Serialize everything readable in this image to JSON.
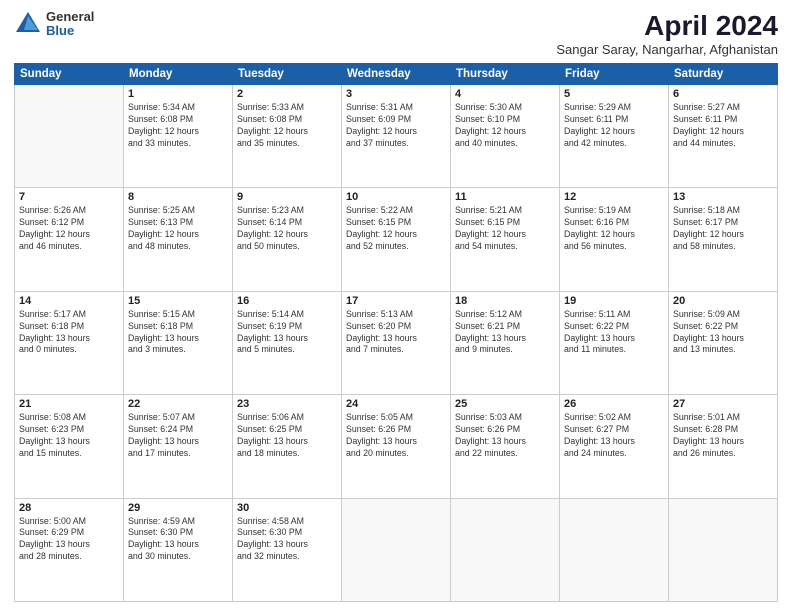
{
  "logo": {
    "general": "General",
    "blue": "Blue"
  },
  "title": {
    "month": "April 2024",
    "location": "Sangar Saray, Nangarhar, Afghanistan"
  },
  "weekdays": [
    "Sunday",
    "Monday",
    "Tuesday",
    "Wednesday",
    "Thursday",
    "Friday",
    "Saturday"
  ],
  "weeks": [
    [
      {
        "day": "",
        "info": ""
      },
      {
        "day": "1",
        "info": "Sunrise: 5:34 AM\nSunset: 6:08 PM\nDaylight: 12 hours\nand 33 minutes."
      },
      {
        "day": "2",
        "info": "Sunrise: 5:33 AM\nSunset: 6:08 PM\nDaylight: 12 hours\nand 35 minutes."
      },
      {
        "day": "3",
        "info": "Sunrise: 5:31 AM\nSunset: 6:09 PM\nDaylight: 12 hours\nand 37 minutes."
      },
      {
        "day": "4",
        "info": "Sunrise: 5:30 AM\nSunset: 6:10 PM\nDaylight: 12 hours\nand 40 minutes."
      },
      {
        "day": "5",
        "info": "Sunrise: 5:29 AM\nSunset: 6:11 PM\nDaylight: 12 hours\nand 42 minutes."
      },
      {
        "day": "6",
        "info": "Sunrise: 5:27 AM\nSunset: 6:11 PM\nDaylight: 12 hours\nand 44 minutes."
      }
    ],
    [
      {
        "day": "7",
        "info": "Sunrise: 5:26 AM\nSunset: 6:12 PM\nDaylight: 12 hours\nand 46 minutes."
      },
      {
        "day": "8",
        "info": "Sunrise: 5:25 AM\nSunset: 6:13 PM\nDaylight: 12 hours\nand 48 minutes."
      },
      {
        "day": "9",
        "info": "Sunrise: 5:23 AM\nSunset: 6:14 PM\nDaylight: 12 hours\nand 50 minutes."
      },
      {
        "day": "10",
        "info": "Sunrise: 5:22 AM\nSunset: 6:15 PM\nDaylight: 12 hours\nand 52 minutes."
      },
      {
        "day": "11",
        "info": "Sunrise: 5:21 AM\nSunset: 6:15 PM\nDaylight: 12 hours\nand 54 minutes."
      },
      {
        "day": "12",
        "info": "Sunrise: 5:19 AM\nSunset: 6:16 PM\nDaylight: 12 hours\nand 56 minutes."
      },
      {
        "day": "13",
        "info": "Sunrise: 5:18 AM\nSunset: 6:17 PM\nDaylight: 12 hours\nand 58 minutes."
      }
    ],
    [
      {
        "day": "14",
        "info": "Sunrise: 5:17 AM\nSunset: 6:18 PM\nDaylight: 13 hours\nand 0 minutes."
      },
      {
        "day": "15",
        "info": "Sunrise: 5:15 AM\nSunset: 6:18 PM\nDaylight: 13 hours\nand 3 minutes."
      },
      {
        "day": "16",
        "info": "Sunrise: 5:14 AM\nSunset: 6:19 PM\nDaylight: 13 hours\nand 5 minutes."
      },
      {
        "day": "17",
        "info": "Sunrise: 5:13 AM\nSunset: 6:20 PM\nDaylight: 13 hours\nand 7 minutes."
      },
      {
        "day": "18",
        "info": "Sunrise: 5:12 AM\nSunset: 6:21 PM\nDaylight: 13 hours\nand 9 minutes."
      },
      {
        "day": "19",
        "info": "Sunrise: 5:11 AM\nSunset: 6:22 PM\nDaylight: 13 hours\nand 11 minutes."
      },
      {
        "day": "20",
        "info": "Sunrise: 5:09 AM\nSunset: 6:22 PM\nDaylight: 13 hours\nand 13 minutes."
      }
    ],
    [
      {
        "day": "21",
        "info": "Sunrise: 5:08 AM\nSunset: 6:23 PM\nDaylight: 13 hours\nand 15 minutes."
      },
      {
        "day": "22",
        "info": "Sunrise: 5:07 AM\nSunset: 6:24 PM\nDaylight: 13 hours\nand 17 minutes."
      },
      {
        "day": "23",
        "info": "Sunrise: 5:06 AM\nSunset: 6:25 PM\nDaylight: 13 hours\nand 18 minutes."
      },
      {
        "day": "24",
        "info": "Sunrise: 5:05 AM\nSunset: 6:26 PM\nDaylight: 13 hours\nand 20 minutes."
      },
      {
        "day": "25",
        "info": "Sunrise: 5:03 AM\nSunset: 6:26 PM\nDaylight: 13 hours\nand 22 minutes."
      },
      {
        "day": "26",
        "info": "Sunrise: 5:02 AM\nSunset: 6:27 PM\nDaylight: 13 hours\nand 24 minutes."
      },
      {
        "day": "27",
        "info": "Sunrise: 5:01 AM\nSunset: 6:28 PM\nDaylight: 13 hours\nand 26 minutes."
      }
    ],
    [
      {
        "day": "28",
        "info": "Sunrise: 5:00 AM\nSunset: 6:29 PM\nDaylight: 13 hours\nand 28 minutes."
      },
      {
        "day": "29",
        "info": "Sunrise: 4:59 AM\nSunset: 6:30 PM\nDaylight: 13 hours\nand 30 minutes."
      },
      {
        "day": "30",
        "info": "Sunrise: 4:58 AM\nSunset: 6:30 PM\nDaylight: 13 hours\nand 32 minutes."
      },
      {
        "day": "",
        "info": ""
      },
      {
        "day": "",
        "info": ""
      },
      {
        "day": "",
        "info": ""
      },
      {
        "day": "",
        "info": ""
      }
    ]
  ]
}
